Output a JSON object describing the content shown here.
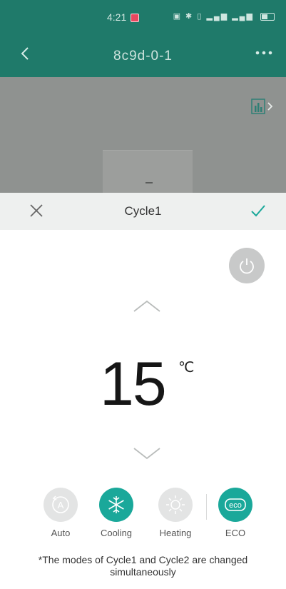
{
  "status_bar": {
    "time": "4:21"
  },
  "nav": {
    "back_icon": "chevron-left-icon",
    "title": "8c9d-0-1",
    "more_icon": "more-dots-icon"
  },
  "background": {
    "chart_icon": "bar-chart-icon"
  },
  "sheet": {
    "close_icon": "close-icon",
    "title": "Cycle1",
    "confirm_icon": "checkmark-icon"
  },
  "power": {
    "icon": "power-icon"
  },
  "temperature": {
    "value": "15",
    "unit": "℃"
  },
  "modes": [
    {
      "label": "Auto",
      "icon": "auto-mode-icon",
      "selected": false
    },
    {
      "label": "Cooling",
      "icon": "snowflake-icon",
      "selected": true
    },
    {
      "label": "Heating",
      "icon": "sun-icon",
      "selected": false
    },
    {
      "label": "ECO",
      "icon": "eco-icon",
      "selected": true
    }
  ],
  "note": "*The modes of Cycle1 and Cycle2 are changed simultaneously",
  "colors": {
    "brand_teal": "#1f7a6a",
    "active_mode": "#1aa89a",
    "inactive_mode": "#e3e4e4"
  }
}
